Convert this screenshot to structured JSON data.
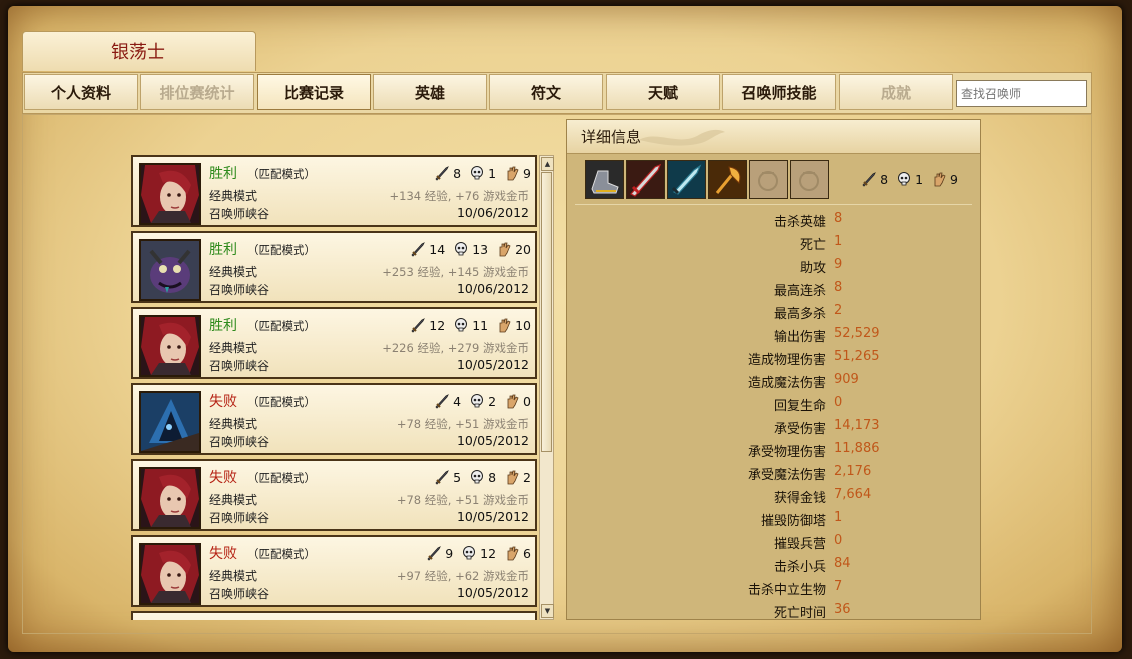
{
  "summoner": {
    "name": "银荡士"
  },
  "tabs": [
    {
      "label": "个人资料",
      "state": "normal"
    },
    {
      "label": "排位赛统计",
      "state": "disabled"
    },
    {
      "label": "比赛记录",
      "state": "active"
    },
    {
      "label": "英雄",
      "state": "normal"
    },
    {
      "label": "符文",
      "state": "normal"
    },
    {
      "label": "天赋",
      "state": "normal"
    },
    {
      "label": "召唤师技能",
      "state": "normal"
    },
    {
      "label": "成就",
      "state": "disabled"
    }
  ],
  "search": {
    "placeholder": "查找召唤师"
  },
  "matches": [
    {
      "result": "胜利",
      "outcome": "win",
      "mode": "（匹配模式）",
      "queue": "经典模式",
      "map": "召唤师峡谷",
      "kills": "8",
      "deaths": "1",
      "assists": "9",
      "reward": "+134 经验, +76 游戏金币",
      "date": "10/06/2012",
      "champion": "red-hair"
    },
    {
      "result": "胜利",
      "outcome": "win",
      "mode": "（匹配模式）",
      "queue": "经典模式",
      "map": "召唤师峡谷",
      "kills": "14",
      "deaths": "13",
      "assists": "20",
      "reward": "+253 经验, +145 游戏金币",
      "date": "10/06/2012",
      "champion": "purple-beast"
    },
    {
      "result": "胜利",
      "outcome": "win",
      "mode": "（匹配模式）",
      "queue": "经典模式",
      "map": "召唤师峡谷",
      "kills": "12",
      "deaths": "11",
      "assists": "10",
      "reward": "+226 经验, +279 游戏金币",
      "date": "10/05/2012",
      "champion": "red-hair"
    },
    {
      "result": "失败",
      "outcome": "loss",
      "mode": "（匹配模式）",
      "queue": "经典模式",
      "map": "召唤师峡谷",
      "kills": "4",
      "deaths": "2",
      "assists": "0",
      "reward": "+78 经验, +51 游戏金币",
      "date": "10/05/2012",
      "champion": "blue-hood"
    },
    {
      "result": "失败",
      "outcome": "loss",
      "mode": "（匹配模式）",
      "queue": "经典模式",
      "map": "召唤师峡谷",
      "kills": "5",
      "deaths": "8",
      "assists": "2",
      "reward": "+78 经验, +51 游戏金币",
      "date": "10/05/2012",
      "champion": "red-hair"
    },
    {
      "result": "失败",
      "outcome": "loss",
      "mode": "（匹配模式）",
      "queue": "经典模式",
      "map": "召唤师峡谷",
      "kills": "9",
      "deaths": "12",
      "assists": "6",
      "reward": "+97 经验, +62 游戏金币",
      "date": "10/05/2012",
      "champion": "red-hair"
    }
  ],
  "detail": {
    "title": "详细信息",
    "kills": "8",
    "deaths": "1",
    "assists": "9",
    "items": [
      "boots-item",
      "sword-item",
      "dagger-item",
      "axe-item",
      "empty-slot",
      "empty-slot"
    ],
    "stats": [
      {
        "label": "击杀英雄",
        "value": "8"
      },
      {
        "label": "死亡",
        "value": "1"
      },
      {
        "label": "助攻",
        "value": "9"
      },
      {
        "label": "最高连杀",
        "value": "8"
      },
      {
        "label": "最高多杀",
        "value": "2"
      },
      {
        "label": "输出伤害",
        "value": "52,529"
      },
      {
        "label": "造成物理伤害",
        "value": "51,265"
      },
      {
        "label": "造成魔法伤害",
        "value": "909"
      },
      {
        "label": "回复生命",
        "value": "0"
      },
      {
        "label": "承受伤害",
        "value": "14,173"
      },
      {
        "label": "承受物理伤害",
        "value": "11,886"
      },
      {
        "label": "承受魔法伤害",
        "value": "2,176"
      },
      {
        "label": "获得金钱",
        "value": "7,664"
      },
      {
        "label": "摧毁防御塔",
        "value": "1"
      },
      {
        "label": "摧毁兵营",
        "value": "0"
      },
      {
        "label": "击杀小兵",
        "value": "84"
      },
      {
        "label": "击杀中立生物",
        "value": "7"
      },
      {
        "label": "死亡时间",
        "value": "36"
      }
    ]
  },
  "colors": {
    "win": "#2e8a1c",
    "loss": "#b52214",
    "stat_value": "#c0571a"
  }
}
